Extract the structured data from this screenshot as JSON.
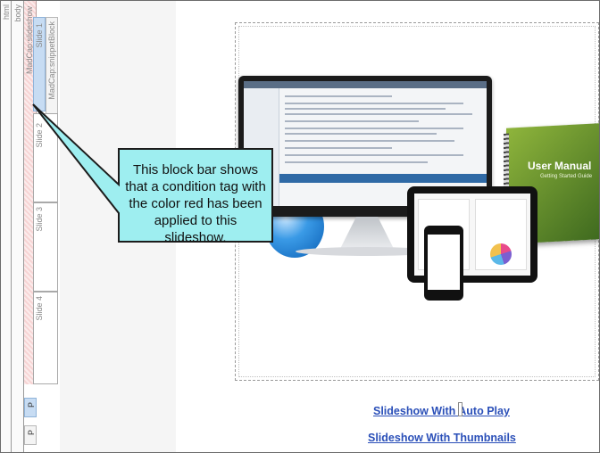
{
  "structure_bars": {
    "html_label": "html",
    "body_label": "body",
    "slideshow_label": "MadCap:slideshow",
    "snippet_label": "MadCap:snippetBlock",
    "slides": [
      "Slide 1",
      "Slide 2",
      "Slide 3",
      "Slide 4"
    ],
    "p_label_1": "P",
    "p_label_2": "P"
  },
  "callout": {
    "text": "This block bar shows that a condition tag with the color red has been applied to this slideshow.",
    "fill_color": "#9eeef0",
    "border_color": "#1c1c1c"
  },
  "image": {
    "book_title": "User Manual",
    "book_subtitle": "Getting Started Guide"
  },
  "links": {
    "auto_play": "Slideshow With Auto Play",
    "thumbnails": "Slideshow With Thumbnails"
  },
  "colors": {
    "condition_tag": "#f7d4d4",
    "selected_block": "#c7dcf3",
    "link": "#2a4fb8"
  }
}
